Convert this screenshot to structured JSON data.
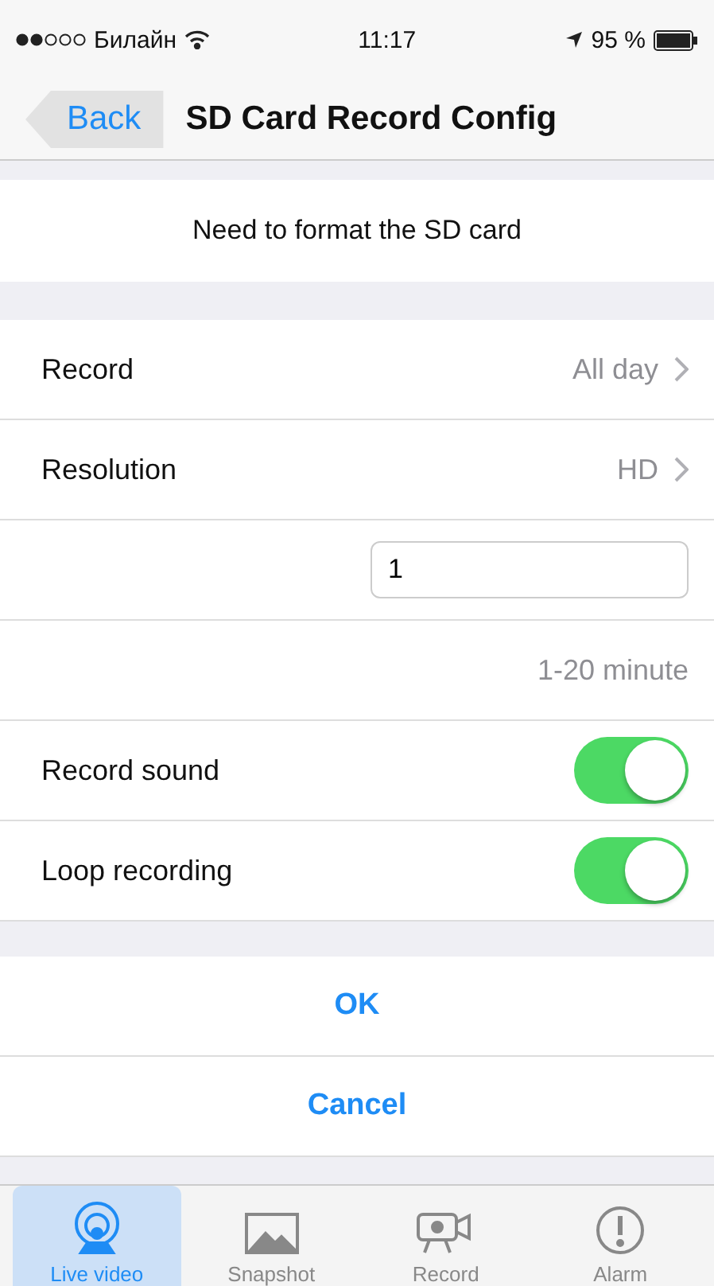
{
  "status_bar": {
    "carrier": "Билайн",
    "time": "11:17",
    "battery": "95 %"
  },
  "nav": {
    "back": "Back",
    "title": "SD Card Record Config"
  },
  "notice": "Need to format the SD card",
  "rows": [
    {
      "kind": "disclosure",
      "label": "Record",
      "value": "All day"
    },
    {
      "kind": "disclosure",
      "label": "Resolution",
      "value": "HD"
    },
    {
      "kind": "input",
      "value": "1"
    },
    {
      "kind": "text",
      "value": "1-20 minute"
    },
    {
      "kind": "toggle",
      "label": "Record sound",
      "on": true
    },
    {
      "kind": "toggle",
      "label": "Loop recording",
      "on": true
    }
  ],
  "actions": [
    "OK",
    "Cancel"
  ],
  "tabs": [
    {
      "label": "Live video",
      "kind": "live",
      "selected": true
    },
    {
      "label": "Snapshot",
      "kind": "snapshot",
      "selected": false
    },
    {
      "label": "Record",
      "kind": "record",
      "selected": false
    },
    {
      "label": "Alarm",
      "kind": "alarm",
      "selected": false
    }
  ]
}
